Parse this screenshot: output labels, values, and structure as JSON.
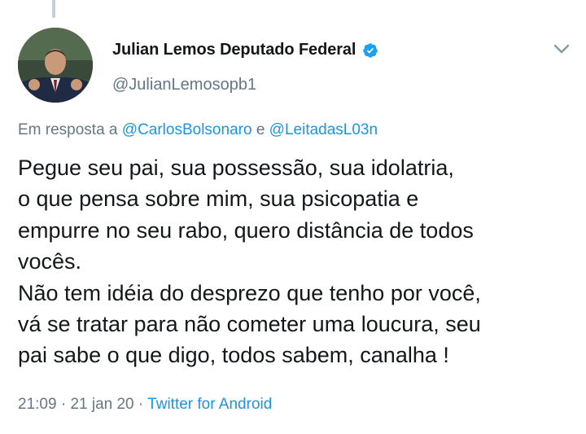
{
  "tweet": {
    "author": {
      "display_name": "Julian Lemos Deputado Federal",
      "handle": "@JulianLemosopb1",
      "verified": true,
      "verified_color": "#1da1f2"
    },
    "reply": {
      "prefix": "Em resposta a",
      "mention1": "@CarlosBolsonaro",
      "conjunction": "e",
      "mention2": "@LeitadasL03n"
    },
    "text": "Pegue seu pai, sua possessão, sua idolatria,\no que pensa sobre mim, sua psicopatia e\nempurre no seu rabo, quero distância de todos\nvocês.\nNão tem idéia do desprezo que tenho por você,\nvá se tratar para não cometer uma loucura, seu\npai sabe o que digo, todos sabem, canalha !",
    "meta": {
      "time": "21:09",
      "date": "21 jan 20",
      "separator": "·",
      "source": "Twitter for Android"
    }
  },
  "colors": {
    "link": "#1b95e0",
    "secondary_text": "#657786",
    "primary_text": "#14171a"
  },
  "icons": {
    "verified": "verified-badge-icon",
    "menu": "chevron-down-icon"
  }
}
